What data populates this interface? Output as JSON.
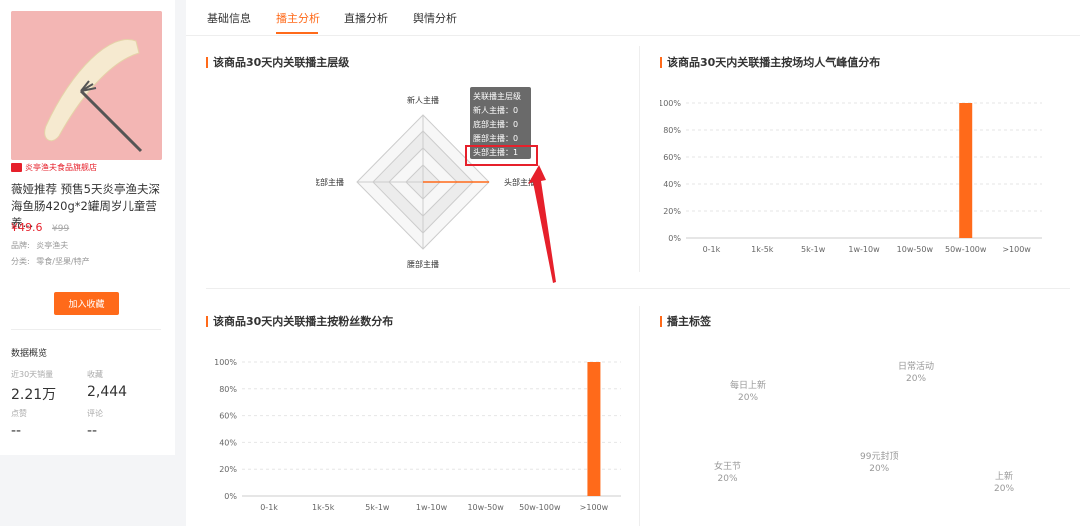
{
  "product": {
    "shop_name": "炎亭渔夫食品旗舰店",
    "title": "薇娅推荐 预售5天炎亭渔夫深海鱼肠420g*2罐周岁儿童营养...",
    "price": "¥49.6",
    "original_price": "¥99",
    "brand_label": "品牌:",
    "brand_value": "炎亭渔夫",
    "category_label": "分类:",
    "category_value": "零食/坚果/特产",
    "fav_button": "加入收藏"
  },
  "overview": {
    "title": "数据概览",
    "sales_label": "近30天销量",
    "sales_value": "2.21万",
    "collect_label": "收藏",
    "collect_value": "2,444",
    "likes_label": "点赞",
    "likes_value": "--",
    "comments_label": "评论",
    "comments_value": "--"
  },
  "tabs": [
    {
      "label": "基础信息",
      "active": false
    },
    {
      "label": "播主分析",
      "active": true
    },
    {
      "label": "直播分析",
      "active": false
    },
    {
      "label": "舆情分析",
      "active": false
    }
  ],
  "sections": {
    "radar_title": "该商品30天内关联播主层级",
    "peak_title": "该商品30天内关联播主按场均人气峰值分布",
    "fans_title": "该商品30天内关联播主按粉丝数分布",
    "tags_title": "播主标签"
  },
  "radar": {
    "labels": {
      "top": "新人主播",
      "left": "底部主播",
      "right": "头部主播",
      "bottom": "腰部主播"
    },
    "tooltip": {
      "title": "关联播主层级",
      "lines": [
        "新人主播：0",
        "底部主播：0",
        "腰部主播：0",
        "头部主播：1"
      ]
    }
  },
  "tags": [
    {
      "name": "日常活动",
      "value": "20%"
    },
    {
      "name": "每日上新",
      "value": "20%"
    },
    {
      "name": "99元封顶",
      "value": "20%"
    },
    {
      "name": "女王节",
      "value": "20%"
    },
    {
      "name": "上新",
      "value": "20%"
    }
  ],
  "colors": {
    "accent": "#ff6a1a",
    "alert": "#e6202b"
  },
  "chart_data": [
    {
      "type": "radar",
      "title": "该商品30天内关联播主层级",
      "axes": [
        "新人主播",
        "头部主播",
        "腰部主播",
        "底部主播"
      ],
      "values": [
        0,
        1,
        0,
        0
      ]
    },
    {
      "type": "bar",
      "title": "该商品30天内关联播主按场均人气峰值分布",
      "categories": [
        "0-1k",
        "1k-5k",
        "5k-1w",
        "1w-10w",
        "10w-50w",
        "50w-100w",
        ">100w"
      ],
      "values": [
        0,
        0,
        0,
        0,
        0,
        100,
        0
      ],
      "yticks": [
        "0%",
        "20%",
        "40%",
        "60%",
        "80%",
        "100%"
      ],
      "ylim": [
        0,
        100
      ],
      "grid": true
    },
    {
      "type": "bar",
      "title": "该商品30天内关联播主按粉丝数分布",
      "categories": [
        "0-1k",
        "1k-5k",
        "5k-1w",
        "1w-10w",
        "10w-50w",
        "50w-100w",
        ">100w"
      ],
      "values": [
        0,
        0,
        0,
        0,
        0,
        0,
        100
      ],
      "yticks": [
        "0%",
        "20%",
        "40%",
        "60%",
        "80%",
        "100%"
      ],
      "ylim": [
        0,
        100
      ],
      "grid": true
    }
  ]
}
